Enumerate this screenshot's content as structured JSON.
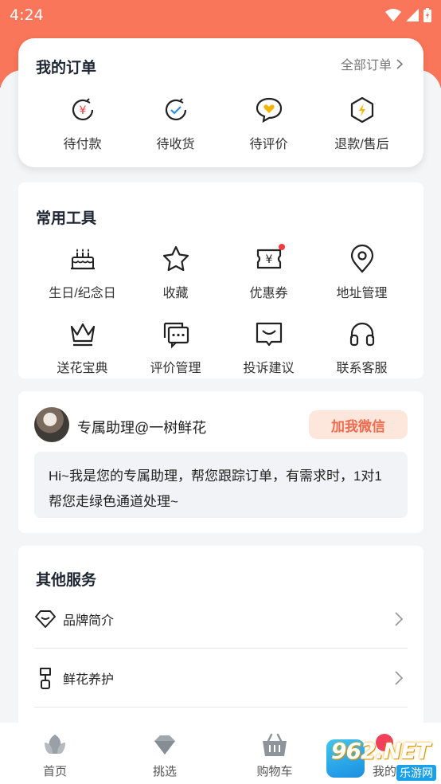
{
  "status_bar": {
    "time": "4:24"
  },
  "orders": {
    "title": "我的订单",
    "all_link": "全部订单",
    "items": [
      {
        "label": "待付款",
        "icon": "payment-pending-icon"
      },
      {
        "label": "待收货",
        "icon": "delivery-pending-icon"
      },
      {
        "label": "待评价",
        "icon": "review-pending-icon"
      },
      {
        "label": "退款/售后",
        "icon": "refund-icon"
      }
    ]
  },
  "tools": {
    "title": "常用工具",
    "items": [
      {
        "label": "生日/纪念日",
        "icon": "cake-icon"
      },
      {
        "label": "收藏",
        "icon": "star-icon"
      },
      {
        "label": "优惠券",
        "icon": "coupon-icon"
      },
      {
        "label": "地址管理",
        "icon": "location-icon"
      },
      {
        "label": "送花宝典",
        "icon": "crown-icon"
      },
      {
        "label": "评价管理",
        "icon": "comment-icon"
      },
      {
        "label": "投诉建议",
        "icon": "feedback-icon"
      },
      {
        "label": "联系客服",
        "icon": "headset-icon"
      }
    ]
  },
  "assistant": {
    "name": "专属助理@一树鲜花",
    "button": "加我微信",
    "message": "Hi~我是您的专属助理，帮您跟踪订单，有需求时，1对1帮您走绿色通道处理~"
  },
  "other_services": {
    "title": "其他服务",
    "items": [
      {
        "label": "品牌简介",
        "icon": "diamond-icon"
      },
      {
        "label": "鲜花养护",
        "icon": "watering-icon"
      }
    ]
  },
  "tabbar": {
    "items": [
      {
        "label": "首页",
        "icon": "home-flower-icon"
      },
      {
        "label": "挑选",
        "icon": "pick-diamond-icon"
      },
      {
        "label": "购物车",
        "icon": "basket-icon"
      },
      {
        "label": "我的",
        "icon": "profile-icon"
      }
    ]
  },
  "watermark": {
    "main": "962.NET",
    "sub": "乐游网"
  },
  "colors": {
    "accent": "#f9765a",
    "button_bg": "#fde6dc",
    "button_text": "#f06b4e",
    "icon_blue": "#2e8de8",
    "icon_yellow": "#f5b400",
    "badge_red": "#f03c3c"
  }
}
